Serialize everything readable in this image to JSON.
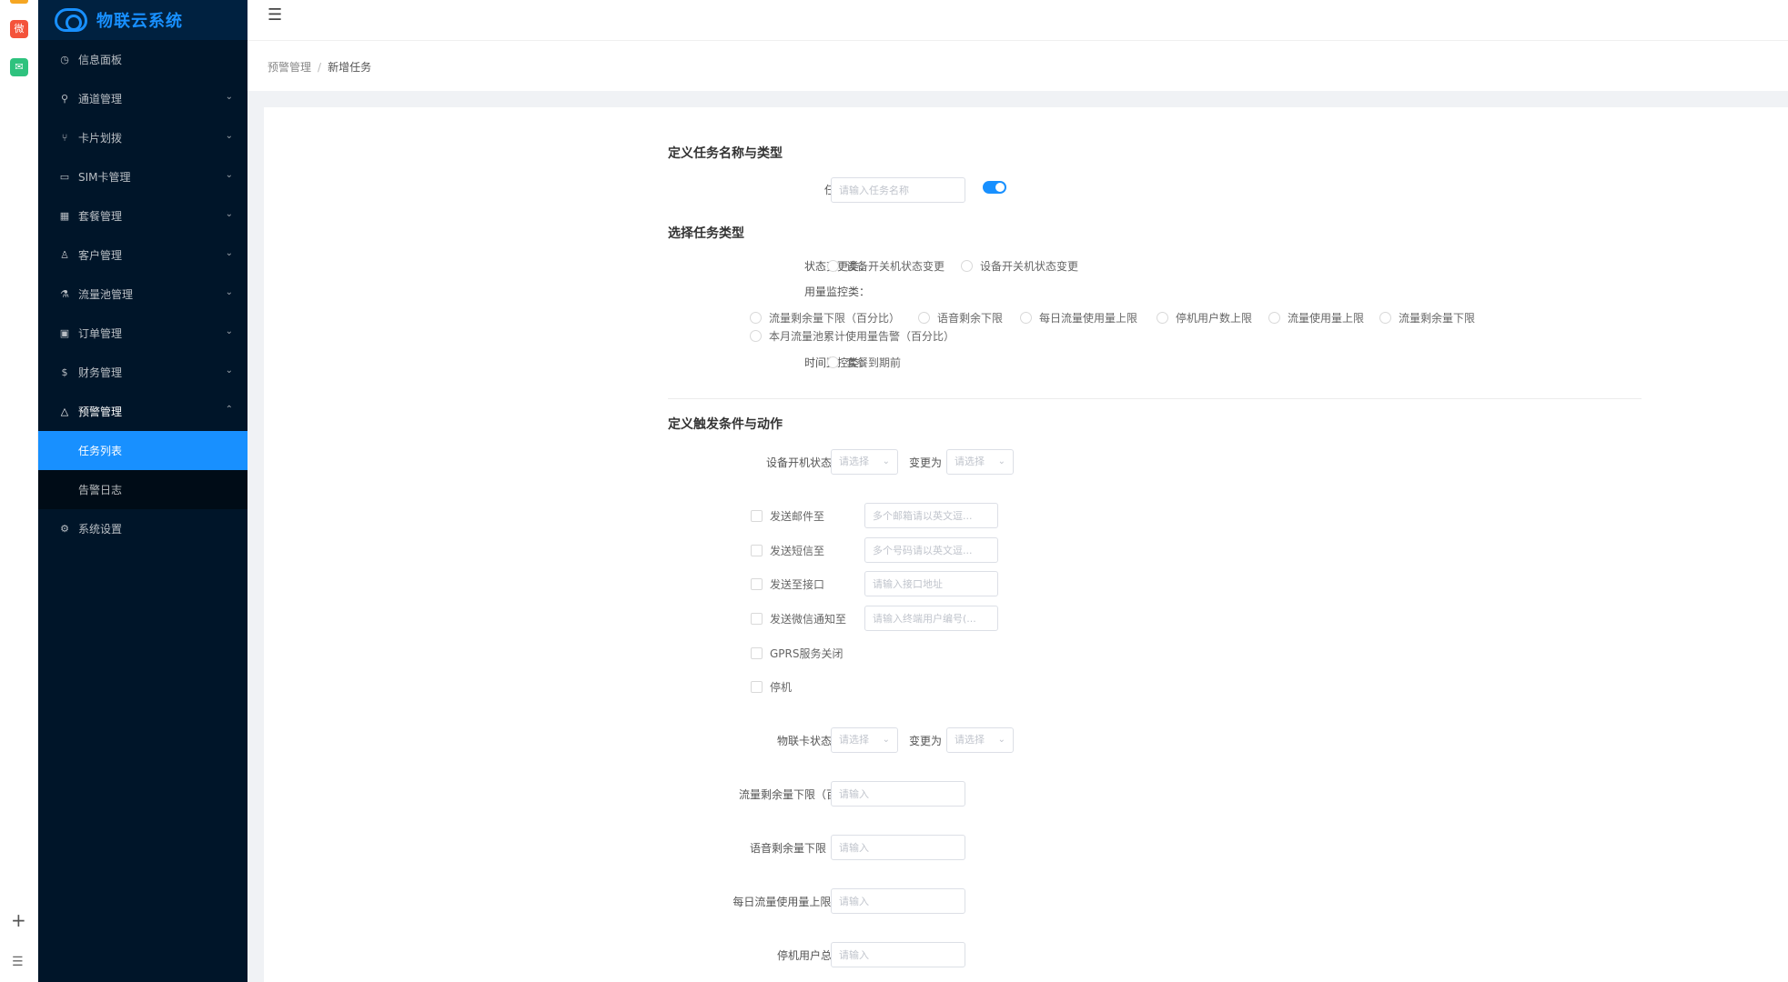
{
  "app": {
    "title": "物联云系统"
  },
  "sidebar": {
    "items": [
      {
        "label": "信息面板",
        "icon": "dashboard-icon"
      },
      {
        "label": "通道管理",
        "icon": "channel-icon"
      },
      {
        "label": "卡片划拨",
        "icon": "branch-icon"
      },
      {
        "label": "SIM卡管理",
        "icon": "card-icon"
      },
      {
        "label": "套餐管理",
        "icon": "grid-icon"
      },
      {
        "label": "客户管理",
        "icon": "user-icon"
      },
      {
        "label": "流量池管理",
        "icon": "flask-icon"
      },
      {
        "label": "订单管理",
        "icon": "order-icon"
      },
      {
        "label": "财务管理",
        "icon": "finance-icon"
      },
      {
        "label": "预警管理",
        "icon": "warning-icon"
      }
    ],
    "submenu": [
      {
        "label": "任务列表"
      },
      {
        "label": "告警日志"
      }
    ],
    "settings": {
      "label": "系统设置",
      "icon": "gear-icon"
    }
  },
  "breadcrumb": {
    "parent": "预警管理",
    "separator": "/",
    "current": "新增任务"
  },
  "form": {
    "section1_title": "定义任务名称与类型",
    "task_name_label": "任务名称：",
    "task_name_placeholder": "请输入任务名称",
    "section2_title": "选择任务类型",
    "status_change_label": "状态变更类：",
    "status_options": [
      "设备开关机状态变更",
      "设备开关机状态变更"
    ],
    "usage_monitor_label": "用量监控类：",
    "usage_options": [
      "流量剩余量下限（百分比）",
      "语音剩余下限",
      "每日流量使用量上限",
      "停机用户数上限",
      "流量使用量上限",
      "流量剩余量下限",
      "本月流量池累计使用量告警（百分比）"
    ],
    "time_monitor_label": "时间监控类：",
    "time_options": [
      "套餐到期前"
    ],
    "section3_title": "定义触发条件与动作",
    "device_change_label": "设备开机状态变更从：",
    "select_placeholder": "请选择",
    "change_to": "变更为",
    "actions": [
      {
        "label": "发送邮件至",
        "placeholder": "多个邮箱请以英文逗..."
      },
      {
        "label": "发送短信至",
        "placeholder": "多个号码请以英文逗..."
      },
      {
        "label": "发送至接口",
        "placeholder": "请输入接口地址"
      },
      {
        "label": "发送微信通知至",
        "placeholder": "请输入终端用户编号(..."
      },
      {
        "label": "GPRS服务关闭"
      },
      {
        "label": "停机"
      }
    ],
    "card_change_label": "物联卡状态变更从：",
    "thresholds": [
      {
        "label": "流量剩余量下限（百分比）：",
        "placeholder": "请输入"
      },
      {
        "label": "语音剩余量下限（分钟）：",
        "placeholder": "请输入"
      },
      {
        "label": "每日流量使用量上限（MB）：",
        "placeholder": "请输入"
      },
      {
        "label": "停机用户总数阈值：",
        "placeholder": "请输入"
      }
    ]
  }
}
